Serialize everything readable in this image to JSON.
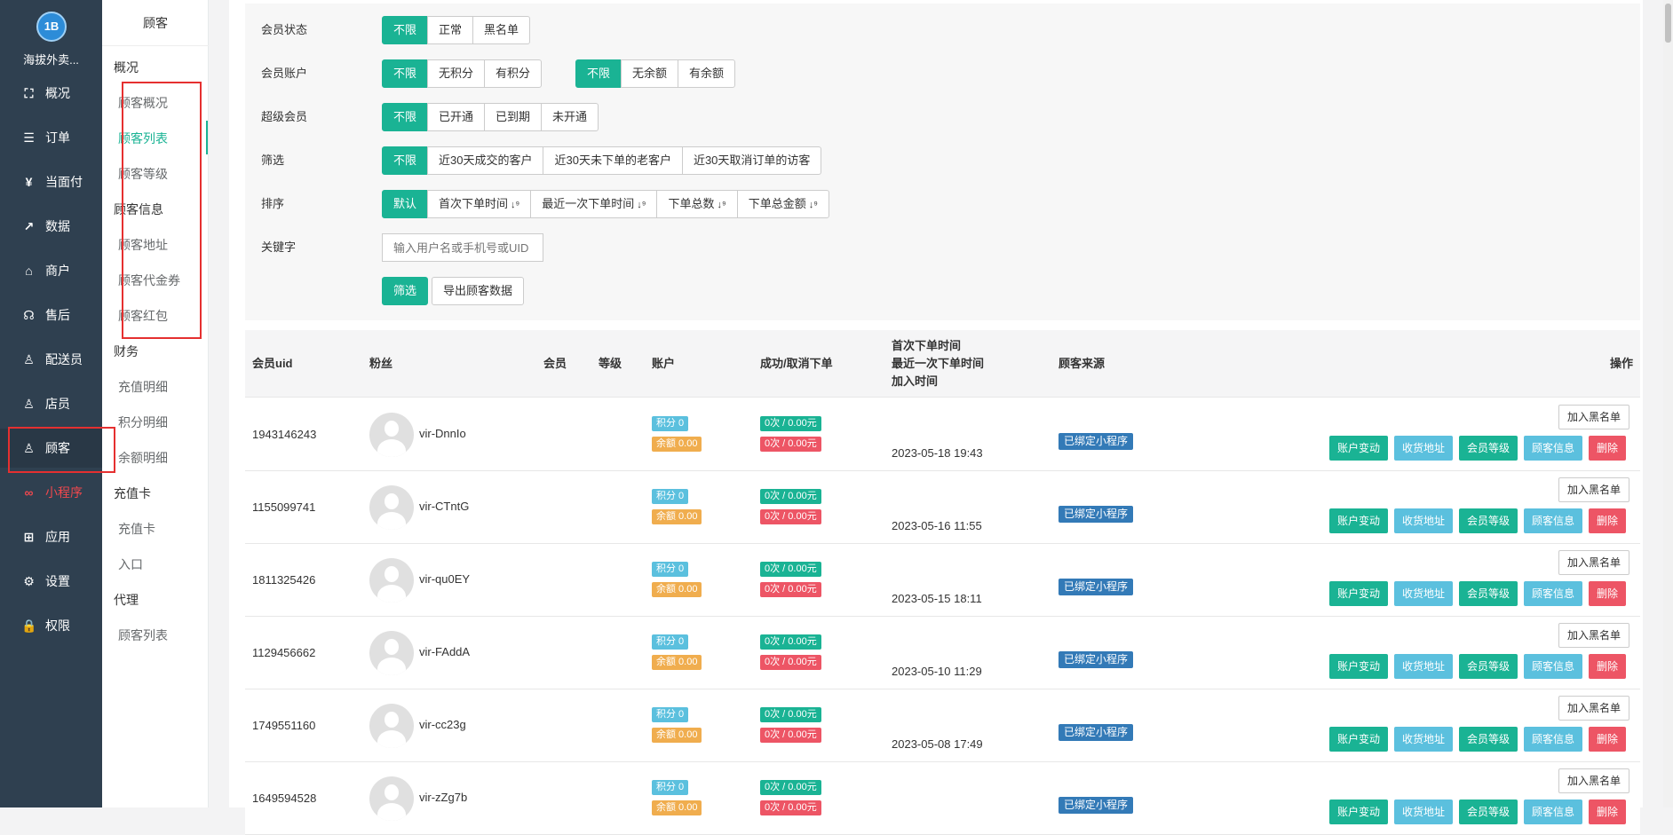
{
  "sidebar": {
    "logo_text": "1B",
    "shop_name": "海拔外卖...",
    "items": [
      {
        "label": "概况",
        "icon": "overview-icon",
        "glyph": "⛶"
      },
      {
        "label": "订单",
        "icon": "orders-icon",
        "glyph": "☰"
      },
      {
        "label": "当面付",
        "icon": "yen-icon",
        "glyph": "¥"
      },
      {
        "label": "数据",
        "icon": "chart-icon",
        "glyph": "↗"
      },
      {
        "label": "商户",
        "icon": "store-icon",
        "glyph": "⌂"
      },
      {
        "label": "售后",
        "icon": "headset-icon",
        "glyph": "☊"
      },
      {
        "label": "配送员",
        "icon": "person-icon",
        "glyph": "♙"
      },
      {
        "label": "店员",
        "icon": "staff-icon",
        "glyph": "♙"
      },
      {
        "label": "顾客",
        "icon": "customer-icon",
        "glyph": "♙"
      },
      {
        "label": "小程序",
        "icon": "miniprogram-icon",
        "glyph": "∞"
      },
      {
        "label": "应用",
        "icon": "apps-icon",
        "glyph": "⊞"
      },
      {
        "label": "设置",
        "icon": "gear-icon",
        "glyph": "⚙"
      },
      {
        "label": "权限",
        "icon": "lock-icon",
        "glyph": "🔒"
      }
    ]
  },
  "subnav": {
    "title": "顾客",
    "items": [
      {
        "label": "概况",
        "kind": "grp"
      },
      {
        "label": "顾客概况",
        "kind": "it"
      },
      {
        "label": "顾客列表",
        "kind": "it"
      },
      {
        "label": "顾客等级",
        "kind": "it"
      },
      {
        "label": "顾客信息",
        "kind": "grp"
      },
      {
        "label": "顾客地址",
        "kind": "it"
      },
      {
        "label": "顾客代金券",
        "kind": "it"
      },
      {
        "label": "顾客红包",
        "kind": "it"
      },
      {
        "label": "财务",
        "kind": "grp"
      },
      {
        "label": "充值明细",
        "kind": "it"
      },
      {
        "label": "积分明细",
        "kind": "it"
      },
      {
        "label": "余额明细",
        "kind": "it"
      },
      {
        "label": "充值卡",
        "kind": "grp"
      },
      {
        "label": "充值卡",
        "kind": "it"
      },
      {
        "label": "入口",
        "kind": "it"
      },
      {
        "label": "代理",
        "kind": "grp"
      },
      {
        "label": "顾客列表",
        "kind": "it"
      }
    ]
  },
  "filters": {
    "member_status": {
      "label": "会员状态",
      "options": [
        "不限",
        "正常",
        "黑名单"
      ]
    },
    "member_account": {
      "label": "会员账户",
      "options_points": [
        "不限",
        "无积分",
        "有积分"
      ],
      "options_balance": [
        "不限",
        "无余额",
        "有余额"
      ]
    },
    "super_member": {
      "label": "超级会员",
      "options": [
        "不限",
        "已开通",
        "已到期",
        "未开通"
      ]
    },
    "screen": {
      "label": "筛选",
      "options": [
        "不限",
        "近30天成交的客户",
        "近30天未下单的老客户",
        "近30天取消订单的访客"
      ]
    },
    "sort": {
      "label": "排序",
      "options": [
        "默认",
        "首次下单时间",
        "最近一次下单时间",
        "下单总数",
        "下单总金额"
      ],
      "sort_glyph": "↓⁹"
    },
    "keyword": {
      "label": "关键字",
      "placeholder": "输入用户名或手机号或UID"
    },
    "filter_button": "筛选",
    "export_button": "导出顾客数据"
  },
  "table": {
    "headers": {
      "uid": "会员uid",
      "fans": "粉丝",
      "member": "会员",
      "level": "等级",
      "account": "账户",
      "orders": "成功/取消下单",
      "time1": "首次下单时间",
      "time2": "最近一次下单时间",
      "time3": "加入时间",
      "source": "顾客来源",
      "ops": "操作"
    },
    "rows": [
      {
        "uid": "1943146243",
        "name": "vir-DnnIo",
        "points": "积分 0",
        "balance": "余额 0.00",
        "success": "0次 / 0.00元",
        "cancel": "0次 / 0.00元",
        "joined": "2023-05-18 19:43",
        "source": "已绑定小程序"
      },
      {
        "uid": "1155099741",
        "name": "vir-CTntG",
        "points": "积分 0",
        "balance": "余额 0.00",
        "success": "0次 / 0.00元",
        "cancel": "0次 / 0.00元",
        "joined": "2023-05-16 11:55",
        "source": "已绑定小程序"
      },
      {
        "uid": "1811325426",
        "name": "vir-qu0EY",
        "points": "积分 0",
        "balance": "余额 0.00",
        "success": "0次 / 0.00元",
        "cancel": "0次 / 0.00元",
        "joined": "2023-05-15 18:11",
        "source": "已绑定小程序"
      },
      {
        "uid": "1129456662",
        "name": "vir-FAddA",
        "points": "积分 0",
        "balance": "余额 0.00",
        "success": "0次 / 0.00元",
        "cancel": "0次 / 0.00元",
        "joined": "2023-05-10 11:29",
        "source": "已绑定小程序"
      },
      {
        "uid": "1749551160",
        "name": "vir-cc23g",
        "points": "积分 0",
        "balance": "余额 0.00",
        "success": "0次 / 0.00元",
        "cancel": "0次 / 0.00元",
        "joined": "2023-05-08 17:49",
        "source": "已绑定小程序"
      },
      {
        "uid": "1649594528",
        "name": "vir-zZg7b",
        "points": "积分 0",
        "balance": "余额 0.00",
        "success": "0次 / 0.00元",
        "cancel": "0次 / 0.00元",
        "joined": "",
        "source": "已绑定小程序"
      }
    ],
    "row_actions": {
      "blacklist": "加入黑名单",
      "account_change": "账户变动",
      "address": "收货地址",
      "level": "会员等级",
      "info": "顾客信息",
      "delete": "删除"
    }
  },
  "colors": {
    "primary": "#1ab394",
    "sidebar": "#2f4050",
    "danger": "#ed5565",
    "info": "#5bc0de",
    "warning": "#f0ad4e",
    "navy": "#337ab7",
    "highlight_box": "#e53030"
  }
}
